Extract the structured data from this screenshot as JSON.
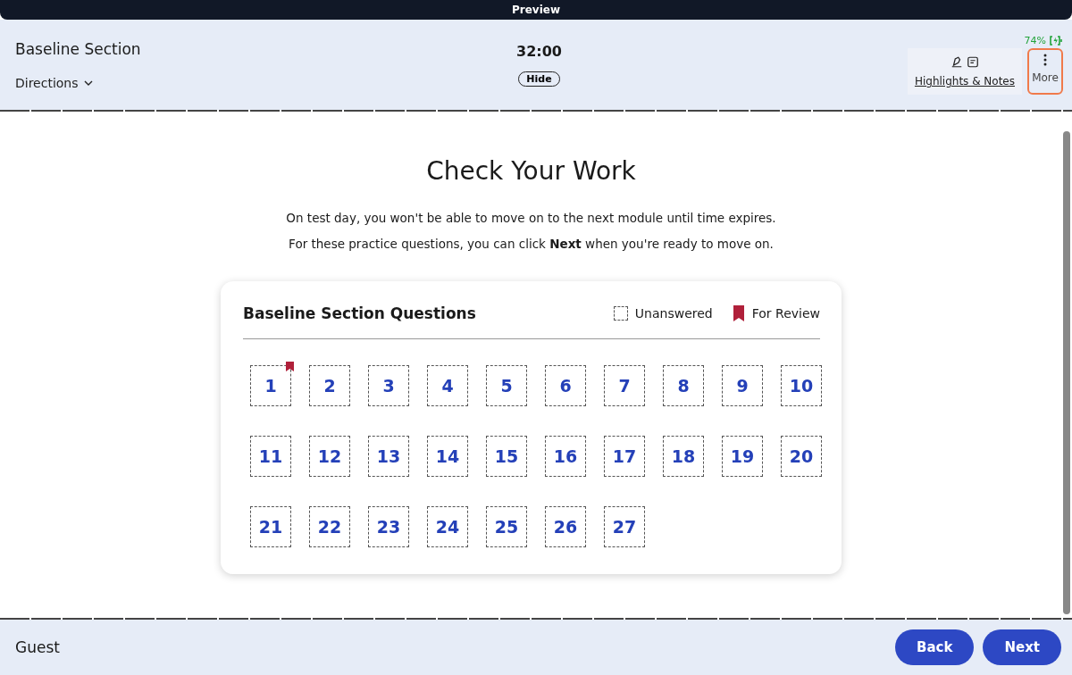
{
  "top_bar": {
    "title": "Preview"
  },
  "header": {
    "section_title": "Baseline Section",
    "directions": "Directions",
    "timer": "32:00",
    "hide_button": "Hide",
    "battery": "74%",
    "highlights_notes": "Highlights & Notes",
    "more": {
      "label": "More",
      "selected": true
    }
  },
  "main": {
    "heading": "Check Your Work",
    "paragraphs": [
      "On test day, you won't be able to move on to the next module until time expires.",
      "For these practice questions, you can click **Next** when you're ready to move on."
    ]
  },
  "card": {
    "title": "Baseline Section Questions",
    "legend": [
      {
        "kind": "unanswered",
        "label": "Unanswered"
      },
      {
        "kind": "review",
        "label": "For Review"
      }
    ],
    "questions": [
      {
        "number": "1",
        "answered": false,
        "flagged": true
      },
      {
        "number": "2",
        "answered": false,
        "flagged": false
      },
      {
        "number": "3",
        "answered": false,
        "flagged": false
      },
      {
        "number": "4",
        "answered": false,
        "flagged": false
      },
      {
        "number": "5",
        "answered": false,
        "flagged": false
      },
      {
        "number": "6",
        "answered": false,
        "flagged": false
      },
      {
        "number": "7",
        "answered": false,
        "flagged": false
      },
      {
        "number": "8",
        "answered": false,
        "flagged": false
      },
      {
        "number": "9",
        "answered": false,
        "flagged": false
      },
      {
        "number": "10",
        "answered": false,
        "flagged": false
      },
      {
        "number": "11",
        "answered": false,
        "flagged": false
      },
      {
        "number": "12",
        "answered": false,
        "flagged": false
      },
      {
        "number": "13",
        "answered": false,
        "flagged": false
      },
      {
        "number": "14",
        "answered": false,
        "flagged": false
      },
      {
        "number": "15",
        "answered": false,
        "flagged": false
      },
      {
        "number": "16",
        "answered": false,
        "flagged": false
      },
      {
        "number": "17",
        "answered": false,
        "flagged": false
      },
      {
        "number": "18",
        "answered": false,
        "flagged": false
      },
      {
        "number": "19",
        "answered": false,
        "flagged": false
      },
      {
        "number": "20",
        "answered": false,
        "flagged": false
      },
      {
        "number": "21",
        "answered": false,
        "flagged": false
      },
      {
        "number": "22",
        "answered": false,
        "flagged": false
      },
      {
        "number": "23",
        "answered": false,
        "flagged": false
      },
      {
        "number": "24",
        "answered": false,
        "flagged": false
      },
      {
        "number": "25",
        "answered": false,
        "flagged": false
      },
      {
        "number": "26",
        "answered": false,
        "flagged": false
      },
      {
        "number": "27",
        "answered": false,
        "flagged": false
      }
    ]
  },
  "footer": {
    "user": "Guest",
    "buttons": [
      "Back",
      "Next"
    ]
  }
}
